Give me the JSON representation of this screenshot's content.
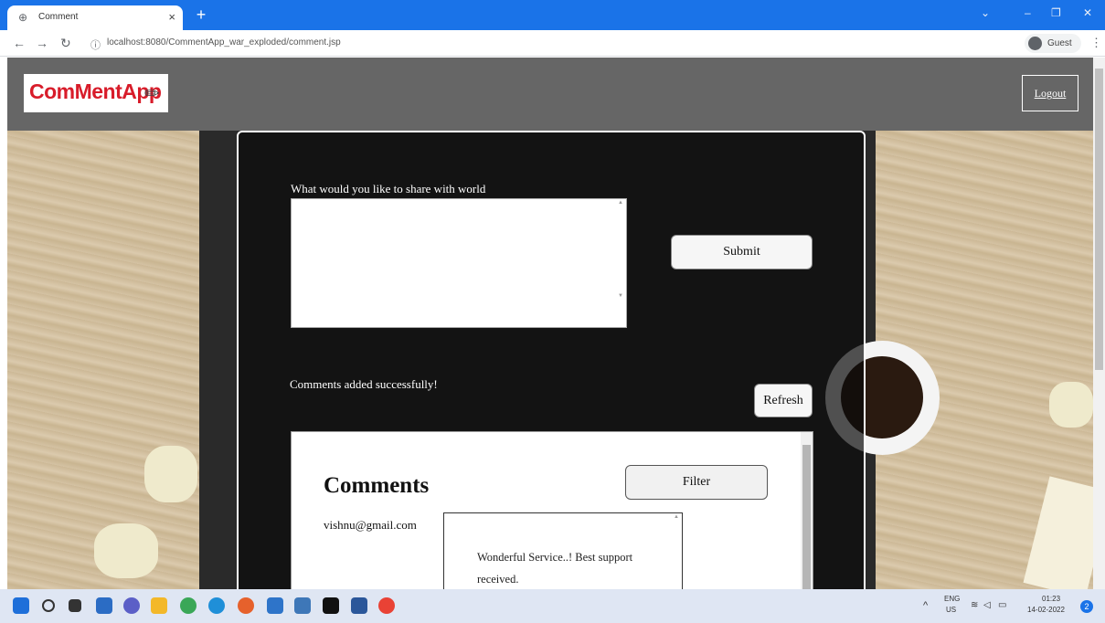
{
  "browser": {
    "tab_title": "Comment",
    "tab_close": "×",
    "new_tab": "+",
    "url": "localhost:8080/CommentApp_war_exploded/comment.jsp",
    "profile_label": "Guest",
    "icons": [
      "back-icon",
      "forward-icon",
      "reload-icon",
      "info-icon",
      "menu-icon"
    ]
  },
  "header": {
    "logo_text": "ComMentApp",
    "logout_label": "Logout"
  },
  "form": {
    "share_label": "What would you like to share with world",
    "textarea_value": "",
    "submit_label": "Submit",
    "success_message": "Comments added successfully!",
    "refresh_label": "Refresh"
  },
  "comments": {
    "heading": "Comments",
    "filter_label": "Filter",
    "items": [
      {
        "author": "vishnu@gmail.com",
        "text": "Wonderful Service..! Best support received."
      }
    ]
  },
  "taskbar": {
    "lang_top": "ENG",
    "lang_bottom": "US",
    "time": "01:23",
    "date": "14-02-2022",
    "notification_count": "2"
  },
  "colors": {
    "browser_accent": "#1a73e8",
    "header_bg": "#666666",
    "logo_red": "#d81c2a"
  }
}
